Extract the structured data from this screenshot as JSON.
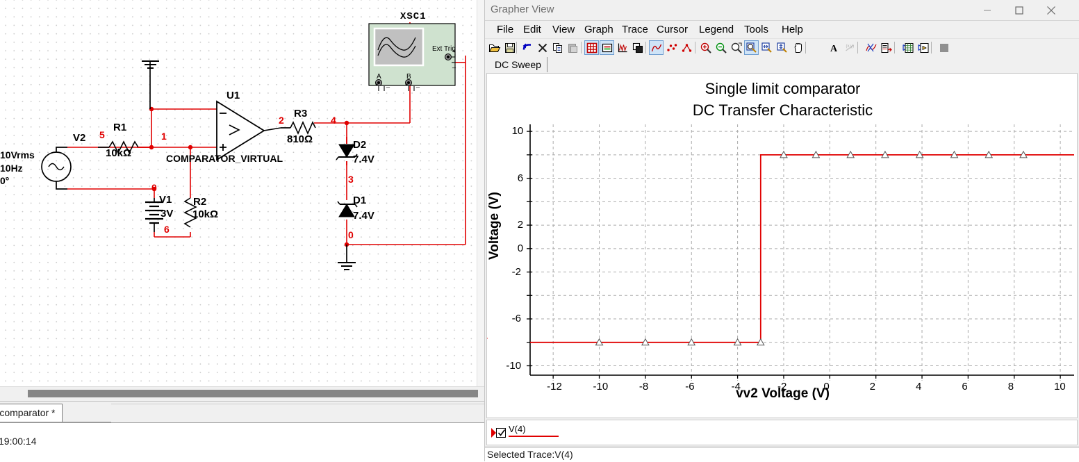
{
  "schematic": {
    "instrument": {
      "ref": "XSC1",
      "terminals": [
        "A",
        "B",
        "Ext Trig"
      ]
    },
    "sources": {
      "v2": {
        "ref": "V2",
        "amplitude": "10Vrms",
        "frequency": "10Hz",
        "phase": "0°"
      },
      "v1": {
        "ref": "V1",
        "value": "3V"
      }
    },
    "components": [
      {
        "ref": "R1",
        "value": "10kΩ"
      },
      {
        "ref": "R2",
        "value": "10kΩ"
      },
      {
        "ref": "R3",
        "value": "810Ω"
      },
      {
        "ref": "D1",
        "value": "7.4V"
      },
      {
        "ref": "D2",
        "value": "7.4V"
      },
      {
        "ref": "U1",
        "value": "COMPARATOR_VIRTUAL"
      }
    ],
    "net_labels": [
      "5",
      "1",
      "0",
      "6",
      "2",
      "4",
      "3",
      "0"
    ],
    "wire_color": "#e00000",
    "sheet_tab": "gle limit comparator *",
    "status_time": "19:00:14"
  },
  "grapher": {
    "window_title": "Grapher View",
    "window_buttons": {
      "minimize": "minimize-icon",
      "maximize": "maximize-icon",
      "close": "close-icon"
    },
    "menu": [
      "File",
      "Edit",
      "View",
      "Graph",
      "Trace",
      "Cursor",
      "Legend",
      "Tools",
      "Help"
    ],
    "toolbar": [
      {
        "name": "open-icon",
        "active": false
      },
      {
        "name": "save-icon",
        "active": false
      },
      {
        "name": "undo-icon",
        "active": false
      },
      {
        "name": "delete-icon",
        "active": false
      },
      {
        "name": "copy-icon",
        "active": false
      },
      {
        "name": "paste-icon",
        "active": false
      },
      {
        "name": "toggle-grid-icon",
        "active": true
      },
      {
        "name": "toggle-legend-icon",
        "active": true
      },
      {
        "name": "axis-properties-icon",
        "active": false
      },
      {
        "name": "page-properties-icon",
        "active": false
      },
      {
        "name": "show-line-icon",
        "active": true
      },
      {
        "name": "show-points-icon",
        "active": false
      },
      {
        "name": "show-line-points-icon",
        "active": false
      },
      {
        "name": "zoom-in-icon",
        "active": false
      },
      {
        "name": "zoom-out-icon",
        "active": false
      },
      {
        "name": "zoom-region-icon",
        "active": false
      },
      {
        "name": "zoom-fit-icon",
        "active": true
      },
      {
        "name": "zoom-horizontal-icon",
        "active": false
      },
      {
        "name": "zoom-vertical-icon",
        "active": false
      },
      {
        "name": "pan-icon",
        "active": false
      },
      {
        "name": "text-icon",
        "active": false
      },
      {
        "name": "measure-icon",
        "active": false
      },
      {
        "name": "cursor-trace-icon",
        "active": false
      },
      {
        "name": "export-data-icon",
        "active": false
      },
      {
        "name": "export-excel-icon",
        "active": false
      },
      {
        "name": "export-labview-icon",
        "active": false
      },
      {
        "name": "stop-icon",
        "active": false
      }
    ],
    "tabs": [
      {
        "label": "DC Sweep",
        "selected": true
      }
    ],
    "legend": {
      "trace_name": "V(4)",
      "checked": true,
      "color": "#e00000"
    },
    "status": "Selected Trace:V(4)"
  },
  "chart_data": {
    "type": "line",
    "title": "Single limit comparator\nDC Transfer Characteristic",
    "title_line1": "Single limit comparator",
    "title_line2": "DC Transfer Characteristic",
    "xlabel": "vv2 Voltage (V)",
    "ylabel": "Voltage (V)",
    "xlim": [
      -13,
      10.6
    ],
    "ylim": [
      -10.8,
      10.6
    ],
    "xticks": [
      -12,
      -10,
      -8,
      -6,
      -4,
      -2,
      0,
      2,
      4,
      6,
      8,
      10
    ],
    "yticks": [
      10,
      8,
      6,
      4,
      2,
      0,
      -2,
      -4,
      -6,
      -8,
      -10
    ],
    "ytick_labels": [
      "10",
      "",
      "6",
      "",
      "2",
      "0",
      "-2",
      "",
      "-6",
      "",
      "-10"
    ],
    "grid": true,
    "legend_position": "bottom",
    "series": [
      {
        "name": "V(4)",
        "color": "#e00000",
        "marker": "triangle",
        "x": [
          -13,
          -10,
          -8,
          -6,
          -4,
          -3,
          -3,
          -2,
          0,
          2,
          4,
          6,
          8,
          10.6
        ],
        "y": [
          -8,
          -8,
          -8,
          -8,
          -8,
          -8,
          8,
          8,
          8,
          8,
          8,
          8,
          8,
          8
        ],
        "marker_points": [
          {
            "x": -10,
            "y": -8
          },
          {
            "x": -8,
            "y": -8
          },
          {
            "x": -6,
            "y": -8
          },
          {
            "x": -4,
            "y": -8
          },
          {
            "x": -3,
            "y": -8
          },
          {
            "x": -2,
            "y": 8
          },
          {
            "x": -0.6,
            "y": 8
          },
          {
            "x": 0.9,
            "y": 8
          },
          {
            "x": 2.4,
            "y": 8
          },
          {
            "x": 3.9,
            "y": 8
          },
          {
            "x": 5.4,
            "y": 8
          },
          {
            "x": 6.9,
            "y": 8
          },
          {
            "x": 8.4,
            "y": 8
          }
        ]
      }
    ]
  }
}
